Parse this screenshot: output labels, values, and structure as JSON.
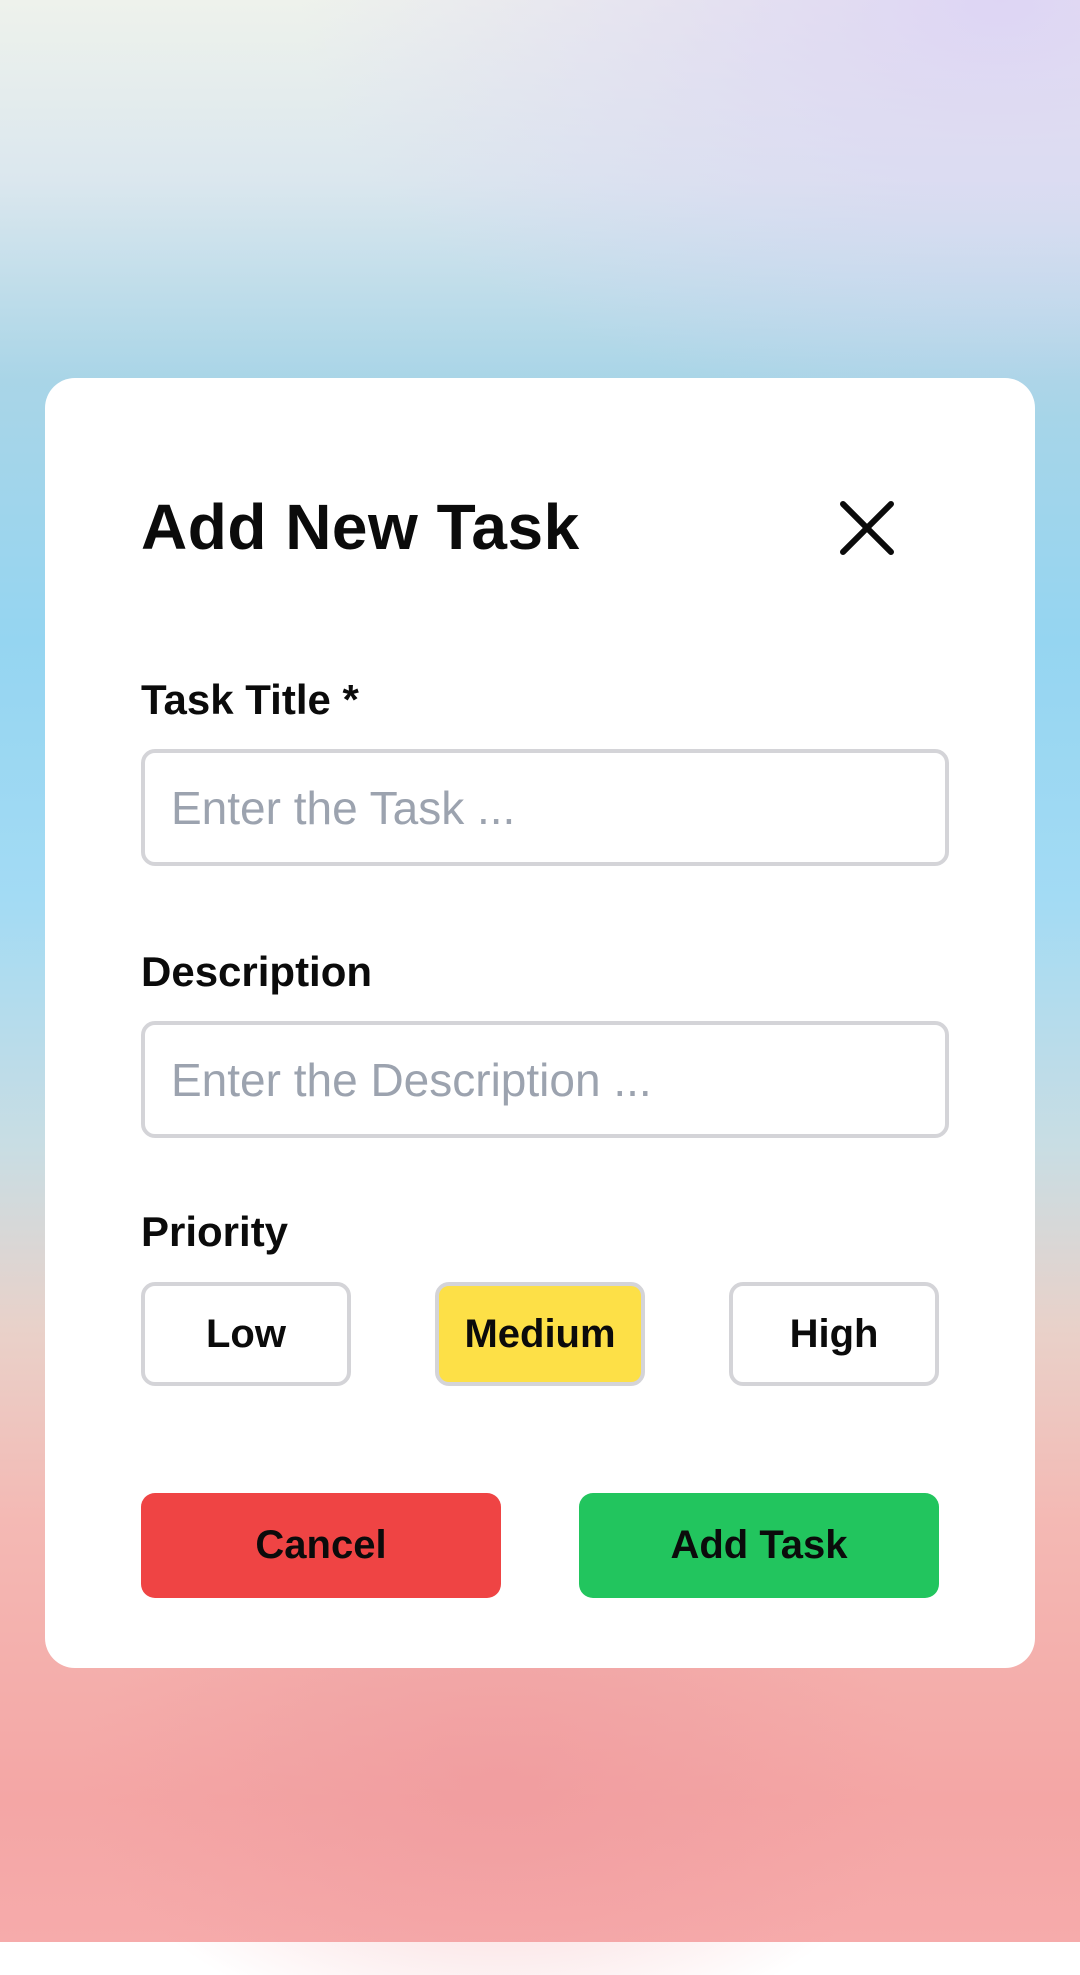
{
  "modal": {
    "title": "Add New Task",
    "close_icon": "close-icon"
  },
  "fields": {
    "task_title": {
      "label": "Task Title *",
      "value": "",
      "placeholder": "Enter the Task ..."
    },
    "description": {
      "label": "Description",
      "value": "",
      "placeholder": "Enter the Description ..."
    }
  },
  "priority": {
    "label": "Priority",
    "options": [
      "Low",
      "Medium",
      "High"
    ],
    "selected": "Medium"
  },
  "actions": {
    "cancel_label": "Cancel",
    "add_label": "Add Task"
  },
  "colors": {
    "selected_priority": "#fde047",
    "cancel": "#ef4444",
    "add": "#22c55e",
    "input_border": "#d4d4d8",
    "placeholder": "#9ca3af"
  }
}
